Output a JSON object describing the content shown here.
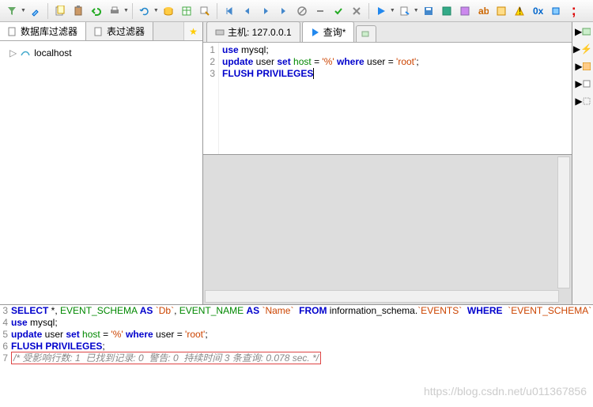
{
  "toolbar": {},
  "left": {
    "tab1": "数据库过滤器",
    "tab2": "表过滤器",
    "tree_root": "localhost"
  },
  "editor": {
    "tab_host_label": "主机: 127.0.0.1",
    "tab_query_label": "查询*",
    "gutter": [
      "1",
      "2",
      "3"
    ],
    "lines": [
      [
        {
          "t": "use ",
          "c": "kw-blue"
        },
        {
          "t": "mysql",
          "c": "kw-ident"
        },
        {
          "t": ";",
          "c": "kw-ident"
        }
      ],
      [
        {
          "t": "update ",
          "c": "kw-blue"
        },
        {
          "t": "user ",
          "c": "kw-ident"
        },
        {
          "t": "set ",
          "c": "kw-blue"
        },
        {
          "t": "host ",
          "c": "kw-green"
        },
        {
          "t": "= ",
          "c": "kw-ident"
        },
        {
          "t": "'%' ",
          "c": "kw-red"
        },
        {
          "t": "where ",
          "c": "kw-blue"
        },
        {
          "t": "user ",
          "c": "kw-ident"
        },
        {
          "t": "= ",
          "c": "kw-ident"
        },
        {
          "t": "'root'",
          "c": "kw-red"
        },
        {
          "t": ";",
          "c": "kw-ident"
        }
      ],
      [
        {
          "t": "FLUSH ",
          "c": "kw-blue"
        },
        {
          "t": "PRIVILEGES",
          "c": "kw-blue"
        }
      ]
    ]
  },
  "log": {
    "gutter": [
      "3",
      "4",
      "5",
      "6",
      "7"
    ],
    "lines": [
      [
        {
          "t": "SELECT ",
          "c": "kw-blue"
        },
        {
          "t": "*, ",
          "c": "kw-ident"
        },
        {
          "t": "EVENT_SCHEMA ",
          "c": "kw-green"
        },
        {
          "t": "AS ",
          "c": "kw-blue"
        },
        {
          "t": "`Db`",
          "c": "kw-red"
        },
        {
          "t": ", ",
          "c": "kw-ident"
        },
        {
          "t": "EVENT_NAME ",
          "c": "kw-green"
        },
        {
          "t": "AS ",
          "c": "kw-blue"
        },
        {
          "t": "`Name` ",
          "c": "kw-red"
        },
        {
          "t": " FROM ",
          "c": "kw-blue"
        },
        {
          "t": "information_schema.",
          "c": "kw-ident"
        },
        {
          "t": "`EVENTS` ",
          "c": "kw-red"
        },
        {
          "t": " WHERE ",
          "c": "kw-blue"
        },
        {
          "t": " `EVENT_SCHEMA`",
          "c": "kw-red"
        }
      ],
      [
        {
          "t": "use ",
          "c": "kw-blue"
        },
        {
          "t": "mysql",
          "c": "kw-ident"
        },
        {
          "t": ";",
          "c": "kw-ident"
        }
      ],
      [
        {
          "t": "update ",
          "c": "kw-blue"
        },
        {
          "t": "user ",
          "c": "kw-ident"
        },
        {
          "t": "set ",
          "c": "kw-blue"
        },
        {
          "t": "host ",
          "c": "kw-green"
        },
        {
          "t": "= ",
          "c": "kw-ident"
        },
        {
          "t": "'%' ",
          "c": "kw-red"
        },
        {
          "t": "where ",
          "c": "kw-blue"
        },
        {
          "t": "user ",
          "c": "kw-ident"
        },
        {
          "t": "= ",
          "c": "kw-ident"
        },
        {
          "t": "'root'",
          "c": "kw-red"
        },
        {
          "t": ";",
          "c": "kw-ident"
        }
      ],
      [
        {
          "t": "FLUSH PRIVILEGES",
          "c": "kw-blue"
        },
        {
          "t": ";",
          "c": "kw-ident"
        }
      ],
      [
        {
          "t": "/* 受影响行数: 1  已找到记录: 0  警告: 0  持续时间 3 条查询: 0.078 sec. */",
          "c": "kw-gray",
          "box": true
        }
      ]
    ]
  },
  "watermark": "https://blog.csdn.net/u011367856"
}
